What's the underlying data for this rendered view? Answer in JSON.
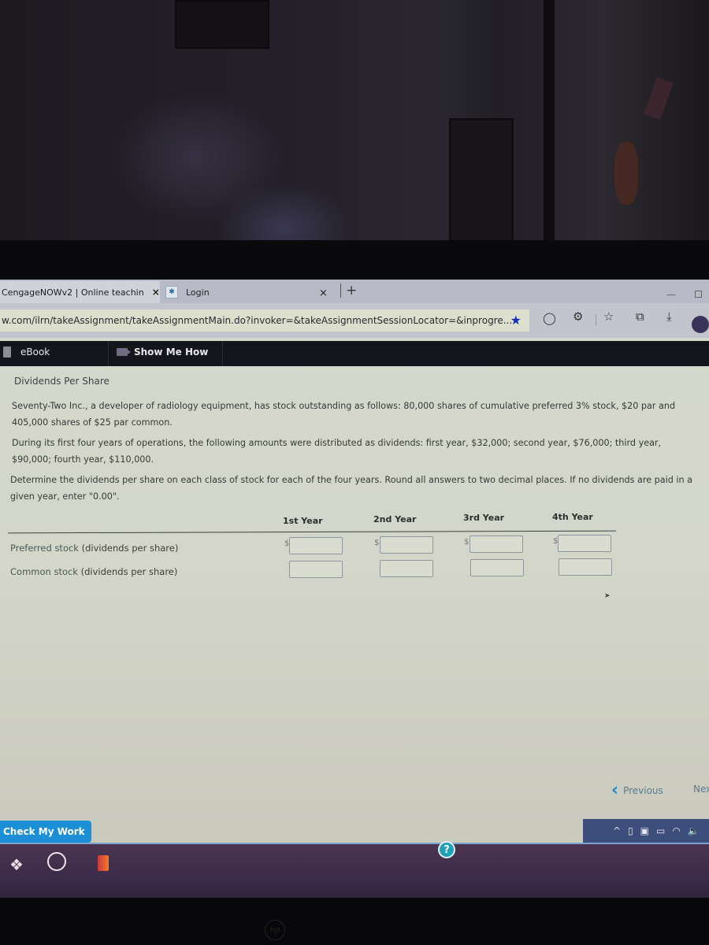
{
  "browser": {
    "tabs": [
      {
        "title": "CengageNOWv2 | Online teachin",
        "active": true
      },
      {
        "title": "Login",
        "active": false
      }
    ],
    "new_tab_symbol": "+",
    "close_symbol": "×",
    "url": "w.com/ilrn/takeAssignment/takeAssignmentMain.do?invoker=&takeAssignmentSessionLocator=&inprogre...",
    "toolbar_icons": [
      "favorite-star-icon",
      "circle-extension-icon",
      "puzzle-extensions-icon",
      "favorites-list-icon",
      "collections-icon",
      "downloads-icon",
      "profile-avatar"
    ]
  },
  "cengage_nav": {
    "ebook_label": "eBook",
    "show_me_how_label": "Show Me How"
  },
  "question": {
    "title": "Dividends Per Share",
    "paragraph1": "Seventy-Two Inc., a developer of radiology equipment, has stock outstanding as follows: 80,000 shares of cumulative preferred 3% stock, $20 par and 405,000 shares of $25 par common.",
    "paragraph2": "During its first four years of operations, the following amounts were distributed as dividends: first year, $32,000; second year, $76,000; third year, $90,000; fourth year, $110,000.",
    "paragraph3": "Determine the dividends per share on each class of stock for each of the four years. Round all answers to two decimal places. If no dividends are paid in a given year, enter \"0.00\"."
  },
  "table": {
    "columns": [
      "1st Year",
      "2nd Year",
      "3rd Year",
      "4th Year"
    ],
    "currency_symbol": "$",
    "rows": [
      {
        "label_main": "Preferred stock",
        "label_paren": "(dividends per share)",
        "values": [
          "",
          "",
          "",
          ""
        ]
      },
      {
        "label_main": "Common stock",
        "label_paren": "(dividends per share)",
        "values": [
          "",
          "",
          "",
          ""
        ]
      }
    ]
  },
  "navigation": {
    "previous_label": "Previous",
    "next_label": "Nex",
    "check_label": "Check My Work"
  },
  "taskbar": {
    "apps": [
      "dropbox-icon",
      "app-arch-icon",
      "office-icon"
    ],
    "help_symbol": "?",
    "tray_icons": [
      "chevron-up-icon",
      "meet-now-icon",
      "screen-icon",
      "battery-icon",
      "wifi-icon",
      "volume-icon"
    ]
  },
  "colors": {
    "check_button": "#1d8fd6",
    "previous_chevron": "#1e88c8",
    "nav_bar": "#14161c",
    "favorite_star": "#1a2fbf"
  }
}
